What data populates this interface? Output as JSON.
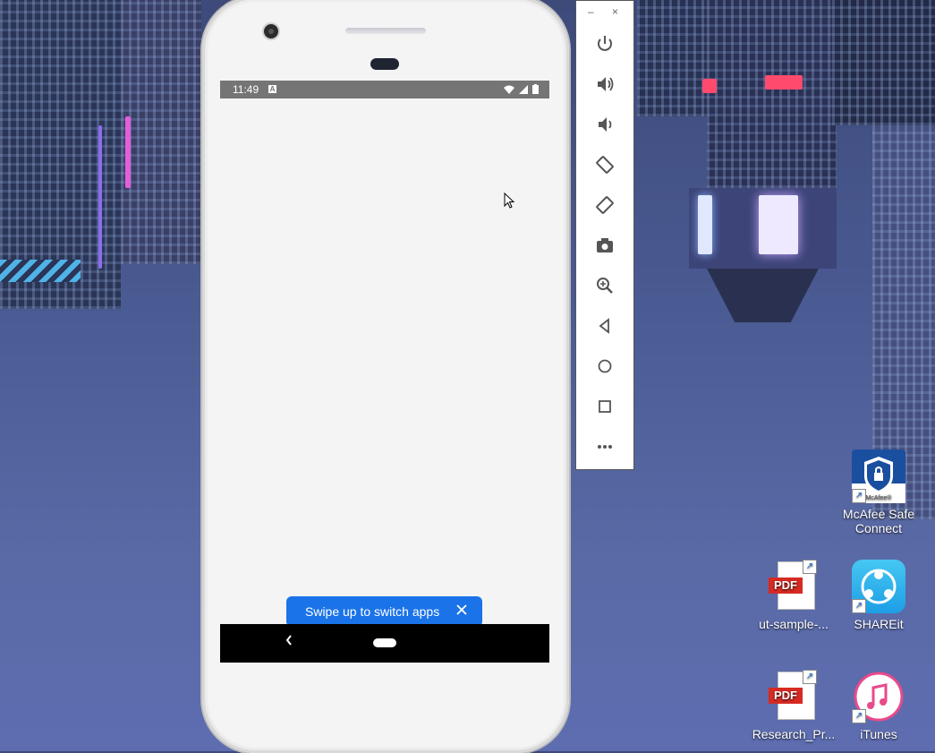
{
  "status_bar": {
    "time": "11:49",
    "notification_icon": "a-icon"
  },
  "toast": {
    "label": "Swipe up to switch apps",
    "close_icon": "close-icon"
  },
  "navbar": {
    "back_icon": "back-chevron-icon",
    "home_icon": "home-pill-icon"
  },
  "toolbar": {
    "minimize_label": "–",
    "close_label": "×",
    "buttons": [
      "power-icon",
      "volume-up-icon",
      "volume-down-icon",
      "rotate-left-icon",
      "rotate-right-icon",
      "camera-icon",
      "zoom-icon",
      "back-triangle-icon",
      "home-circle-icon",
      "overview-square-icon",
      "more-icon"
    ]
  },
  "desktop_icons": [
    {
      "label": "McAfee Safe Connect",
      "icon": "mcafee-icon"
    },
    {
      "label": "ut-sample-...",
      "icon": "pdf-icon",
      "badge": "PDF"
    },
    {
      "label": "SHAREit",
      "icon": "shareit-icon"
    },
    {
      "label": "Research_Pr...",
      "icon": "pdf-icon",
      "badge": "PDF"
    },
    {
      "label": "iTunes",
      "icon": "itunes-icon"
    }
  ],
  "colors": {
    "toast": "#1a73e8",
    "statusbar": "#757575",
    "navbar": "#000000",
    "screen": "#f4f4f4"
  }
}
